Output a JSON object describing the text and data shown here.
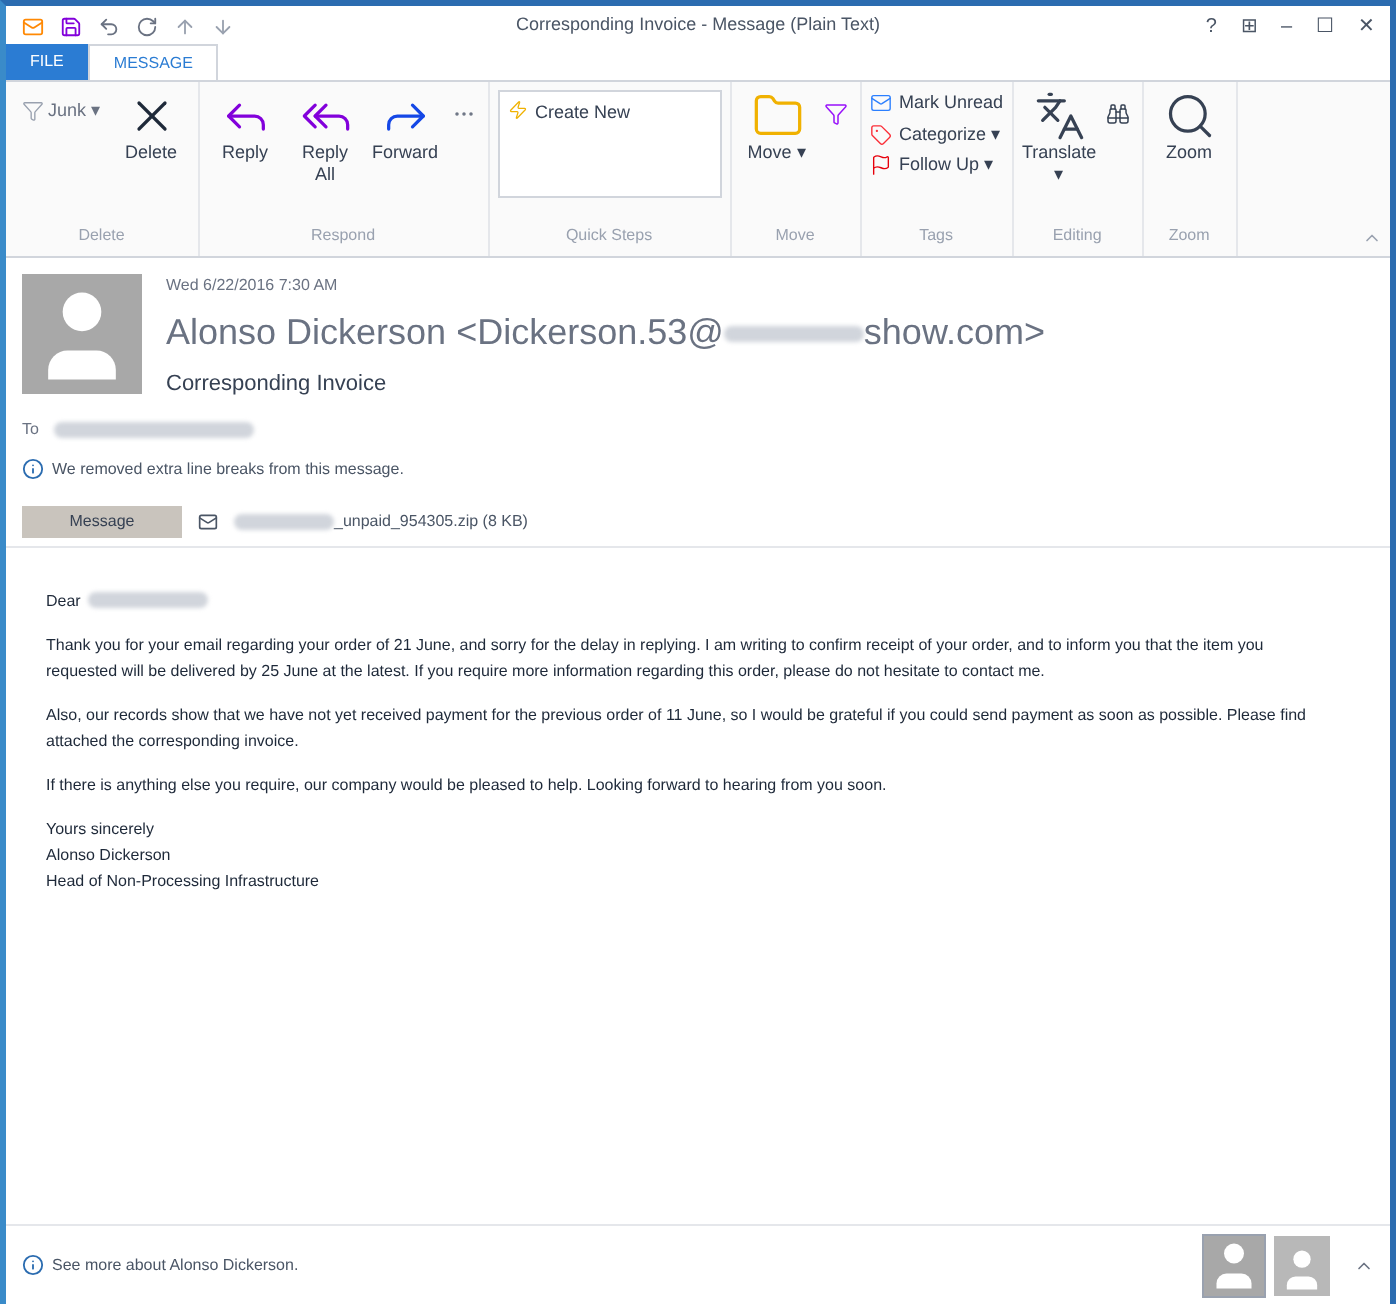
{
  "window": {
    "title": "Corresponding Invoice - Message (Plain Text)",
    "controls": [
      "?",
      "⊞",
      "–",
      "☐",
      "✕"
    ]
  },
  "tabs": [
    {
      "label": "FILE",
      "kind": "file",
      "selected": false
    },
    {
      "label": "MESSAGE",
      "kind": "tab",
      "selected": true
    }
  ],
  "ribbon": {
    "groups": [
      {
        "label": "Delete",
        "items": [
          {
            "kind": "small",
            "label": "Junk ▾"
          },
          {
            "kind": "large",
            "label": "Delete"
          }
        ]
      },
      {
        "label": "Respond",
        "items": [
          {
            "kind": "large",
            "label": "Reply"
          },
          {
            "kind": "large",
            "label": "Reply All"
          },
          {
            "kind": "large",
            "label": "Forward"
          },
          {
            "kind": "stack"
          }
        ]
      },
      {
        "label": "Quick Steps",
        "items": [
          {
            "kind": "gallery",
            "label": "Create New"
          }
        ]
      },
      {
        "label": "Move",
        "items": [
          {
            "kind": "large",
            "label": "Move ▾"
          },
          {
            "kind": "stack"
          }
        ]
      },
      {
        "label": "Tags",
        "items": [
          {
            "kind": "list",
            "entries": [
              {
                "label": "Mark Unread"
              },
              {
                "label": "Categorize ▾"
              },
              {
                "label": "Follow Up ▾"
              }
            ]
          }
        ]
      },
      {
        "label": "Editing",
        "items": [
          {
            "kind": "large",
            "label": "Translate ▾"
          },
          {
            "kind": "stack"
          }
        ]
      },
      {
        "label": "Zoom",
        "items": [
          {
            "kind": "large",
            "label": "Zoom"
          }
        ]
      }
    ]
  },
  "message": {
    "date": "Wed 6/22/2016 7:30 AM",
    "sender_name": "Alonso Dickerson",
    "sender_email_start": "<Dickerson.53@",
    "sender_email_end": "show.com>",
    "subject": "Corresponding Invoice",
    "to_label": "To",
    "info": "We removed extra line breaks from this message.",
    "message_tab": "Message",
    "attachment": "_unpaid_954305.zip (8 KB)"
  },
  "body": {
    "greeting": "Dear",
    "paragraphs": [
      "Thank you for your email regarding your order of 21 June, and sorry for the delay in replying. I am writing to confirm receipt of your order, and to inform you that the item you requested will be delivered by 25 June at the latest. If you require more information regarding this order, please do not hesitate to contact me.",
      "Also, our records show that we have not yet received payment for the previous order of 11 June, so I would be grateful if you could send payment as soon as possible. Please find attached the corresponding invoice.",
      "If there is anything else you require, our company would be pleased to help. Looking forward to hearing from you soon."
    ],
    "signature": [
      "Yours sincerely",
      "Alonso Dickerson",
      "Head of Non-Processing Infrastructure"
    ]
  },
  "people_pane": {
    "text": "See more about Alonso Dickerson."
  }
}
